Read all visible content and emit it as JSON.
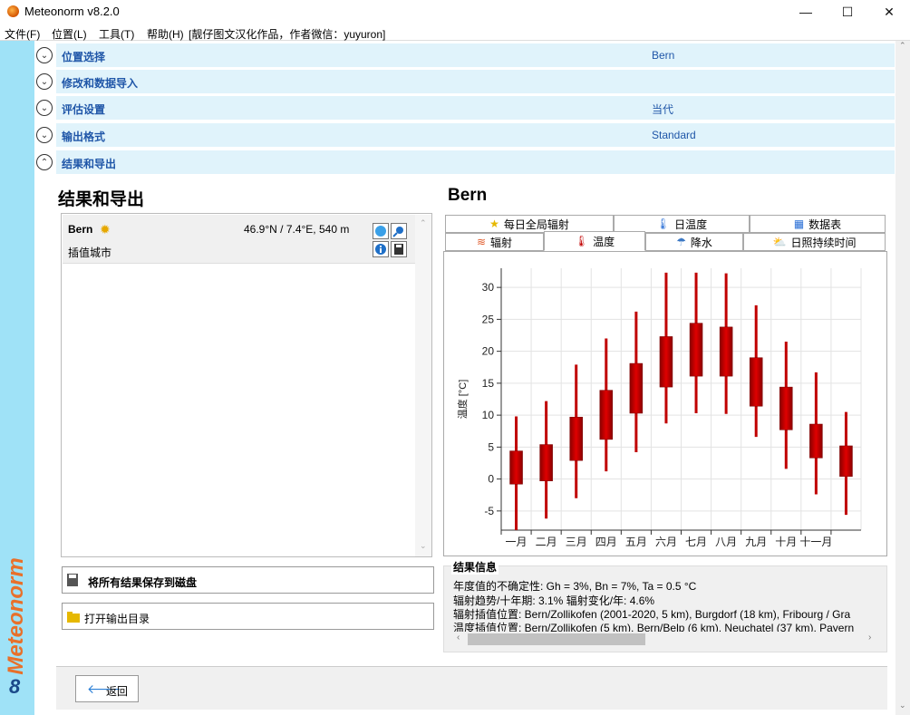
{
  "window": {
    "title": "Meteonorm v8.2.0",
    "minimize": "—",
    "maximize": "☐",
    "close": "✕"
  },
  "menu": {
    "items": [
      "文件(F)",
      "位置(L)",
      "工具(T)",
      "帮助(H)",
      "[靓仔图文汉化作品，作者微信：yuyuron]"
    ]
  },
  "sidebar": {
    "brand": "Meteonorm",
    "step": "8"
  },
  "accordion": [
    {
      "label": "位置选择",
      "value": "Bern",
      "expanded": false
    },
    {
      "label": "修改和数据导入",
      "value": "",
      "expanded": false
    },
    {
      "label": "评估设置",
      "value": "当代",
      "expanded": false
    },
    {
      "label": "输出格式",
      "value": "Standard",
      "expanded": false
    },
    {
      "label": "结果和导出",
      "value": "",
      "expanded": true
    }
  ],
  "left": {
    "heading": "结果和导出",
    "location": {
      "name": "Bern",
      "coords": "46.9°N / 7.4°E, 540 m",
      "type": "插值城市"
    },
    "save_all": "将所有结果保存到磁盘",
    "open_dir": "打开输出目录"
  },
  "right": {
    "heading": "Bern",
    "tabs_row1": [
      "每日全局辐射",
      "日温度",
      "数据表"
    ],
    "tabs_row2": [
      "辐射",
      "温度",
      "降水",
      "日照持续时间"
    ],
    "active_tab": "温度"
  },
  "chart_data": {
    "type": "box",
    "ylabel": "温度 [°C]",
    "xlabel": "",
    "ylim": [
      -8,
      33
    ],
    "yticks": [
      -5,
      0,
      5,
      10,
      15,
      20,
      25,
      30
    ],
    "categories": [
      "一月",
      "二月",
      "三月",
      "四月",
      "五月",
      "六月",
      "七月",
      "八月",
      "九月",
      "十月",
      "十一月",
      ""
    ],
    "min": [
      -8,
      -6.2,
      -3,
      1.2,
      4.2,
      8.7,
      10.3,
      10.2,
      6.6,
      1.6,
      -2.4,
      -5.6
    ],
    "q1": [
      -0.8,
      -0.3,
      2.9,
      6.2,
      10.3,
      14.4,
      16.1,
      16.1,
      11.4,
      7.7,
      3.3,
      0.4
    ],
    "q3": [
      4.4,
      5.4,
      9.7,
      13.9,
      18.1,
      22.3,
      24.4,
      23.8,
      19.0,
      14.4,
      8.6,
      5.2
    ],
    "max": [
      9.8,
      12.2,
      17.9,
      22.0,
      26.2,
      32.3,
      32.3,
      32.2,
      27.2,
      21.5,
      16.7,
      10.5
    ],
    "grid": true,
    "box_color": "#c00000"
  },
  "info": {
    "title": "结果信息",
    "lines": [
      "年度值的不确定性: Gh = 3%, Bn = 7%, Ta = 0.5 °C",
      "辐射趋势/十年期: 3.1%   辐射变化/年: 4.6%",
      "辐射插值位置: Bern/Zollikofen (2001-2020, 5 km), Burgdorf (18 km), Fribourg / Gra",
      "温度插值位置: Bern/Zollikofen (5 km), Bern/Belp (6 km), Neuchatel (37 km), Payern"
    ]
  },
  "footer": {
    "back": "返回"
  }
}
